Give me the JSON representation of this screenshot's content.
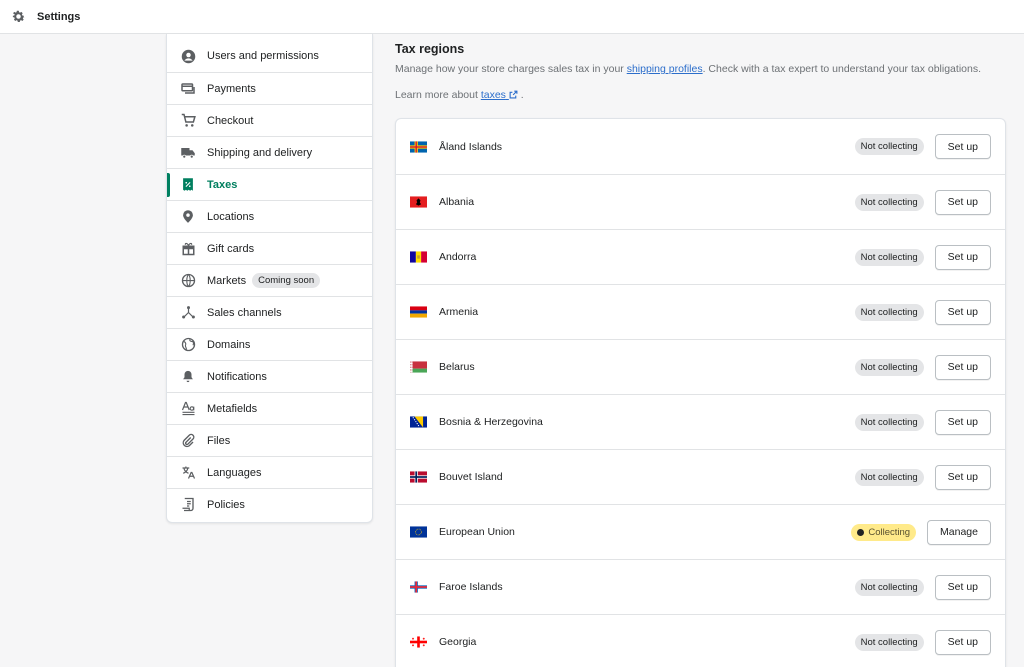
{
  "header": {
    "title": "Settings",
    "icon": "gear-icon"
  },
  "sidebar": {
    "items": [
      {
        "label": "Users and permissions",
        "icon": "user-icon"
      },
      {
        "label": "Payments",
        "icon": "payments-icon"
      },
      {
        "label": "Checkout",
        "icon": "cart-icon"
      },
      {
        "label": "Shipping and delivery",
        "icon": "truck-icon"
      },
      {
        "label": "Taxes",
        "icon": "taxes-icon",
        "active": true
      },
      {
        "label": "Locations",
        "icon": "location-pin-icon"
      },
      {
        "label": "Gift cards",
        "icon": "gift-icon"
      },
      {
        "label": "Markets",
        "icon": "globe-icon",
        "badge": "Coming soon"
      },
      {
        "label": "Sales channels",
        "icon": "channels-icon"
      },
      {
        "label": "Domains",
        "icon": "domain-globe-icon"
      },
      {
        "label": "Notifications",
        "icon": "bell-icon"
      },
      {
        "label": "Metafields",
        "icon": "metafields-icon"
      },
      {
        "label": "Files",
        "icon": "paperclip-icon"
      },
      {
        "label": "Languages",
        "icon": "translate-icon"
      },
      {
        "label": "Policies",
        "icon": "policy-icon"
      }
    ]
  },
  "main": {
    "title": "Tax regions",
    "desc_before": "Manage how your store charges sales tax in your ",
    "desc_link": "shipping profiles",
    "desc_after": ". Check with a tax expert to understand your tax obligations.",
    "learn_prefix": "Learn more about ",
    "learn_link": "taxes",
    "learn_suffix": " ."
  },
  "regions": [
    {
      "name": "Åland Islands",
      "status": "Not collecting",
      "action": "Set up",
      "flag": "aland"
    },
    {
      "name": "Albania",
      "status": "Not collecting",
      "action": "Set up",
      "flag": "albania"
    },
    {
      "name": "Andorra",
      "status": "Not collecting",
      "action": "Set up",
      "flag": "andorra"
    },
    {
      "name": "Armenia",
      "status": "Not collecting",
      "action": "Set up",
      "flag": "armenia"
    },
    {
      "name": "Belarus",
      "status": "Not collecting",
      "action": "Set up",
      "flag": "belarus"
    },
    {
      "name": "Bosnia & Herzegovina",
      "status": "Not collecting",
      "action": "Set up",
      "flag": "bosnia"
    },
    {
      "name": "Bouvet Island",
      "status": "Not collecting",
      "action": "Set up",
      "flag": "norway"
    },
    {
      "name": "European Union",
      "status": "Collecting",
      "action": "Manage",
      "flag": "eu"
    },
    {
      "name": "Faroe Islands",
      "status": "Not collecting",
      "action": "Set up",
      "flag": "faroe"
    },
    {
      "name": "Georgia",
      "status": "Not collecting",
      "action": "Set up",
      "flag": "georgia"
    }
  ],
  "colors": {
    "accent": "#008060",
    "link": "#2c6ecb",
    "collecting_badge": "#ffea8a"
  }
}
